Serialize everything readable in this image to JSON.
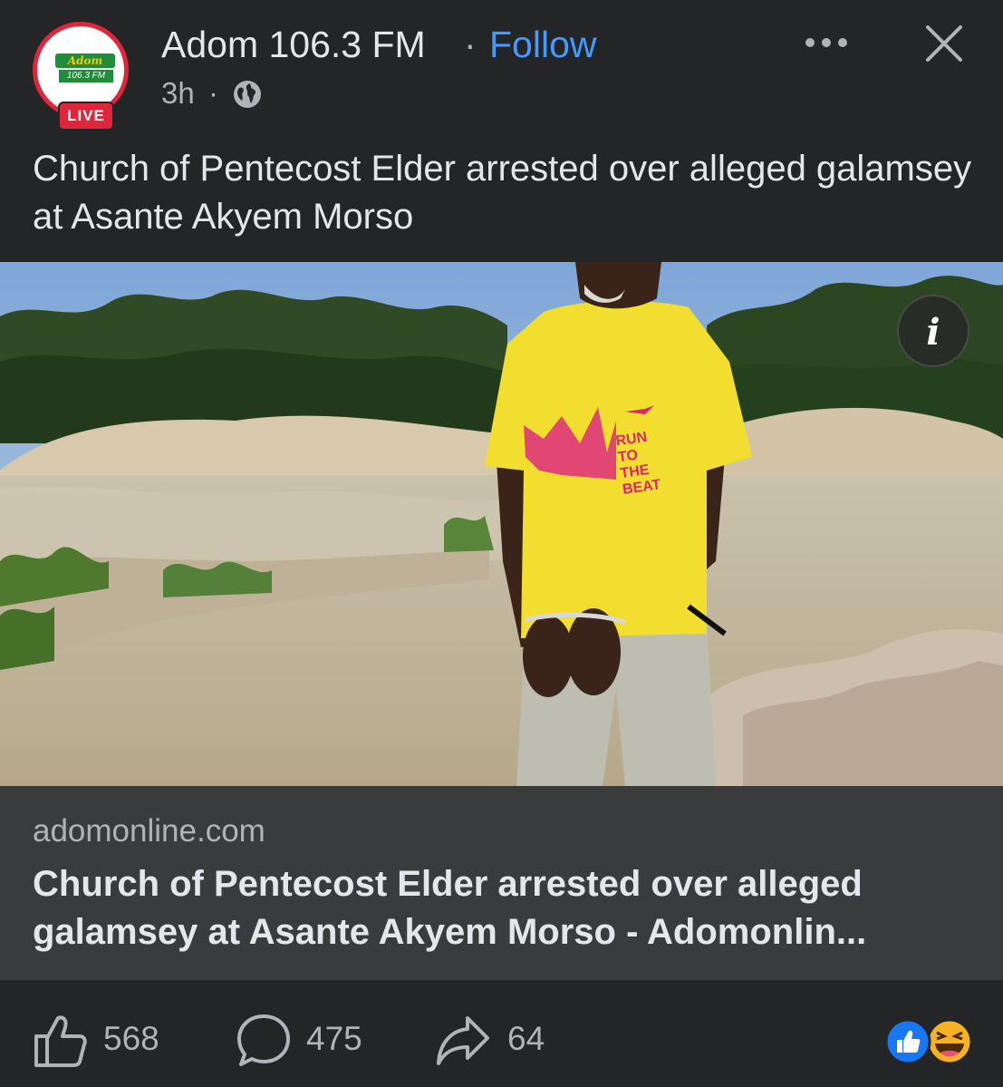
{
  "post": {
    "page_name": "Adom 106.3 FM",
    "separator": "·",
    "follow_label": "Follow",
    "time": "3h",
    "time_separator": "·",
    "live_label": "LIVE",
    "logo_text_top": "Adom",
    "logo_text_bottom": "106.3 FM",
    "caption": "Church of Pentecost Elder arrested over alleged galamsey at Asante Akyem Morso"
  },
  "photo": {
    "shirt_text": [
      "RUN",
      "TO",
      "THE",
      "BEAT"
    ],
    "info_label": "i"
  },
  "link": {
    "domain": "adomonline.com",
    "title": "Church of Pentecost Elder arrested over alleged galamsey at Asante Akyem Morso - Adomonlin..."
  },
  "actions": {
    "likes": "568",
    "comments": "475",
    "shares": "64"
  },
  "icons": {
    "more": "more-horizontal-icon",
    "close": "close-icon",
    "audience": "globe-icon",
    "like": "thumbs-up-icon",
    "comment": "comment-bubble-icon",
    "share": "share-arrow-icon",
    "reaction_like": "like-reaction-icon",
    "reaction_haha": "haha-reaction-icon"
  },
  "colors": {
    "background": "#242526",
    "link_card": "#3a3b3c",
    "follow_blue": "#4599ff",
    "live_red": "#e0263a",
    "secondary_text": "#b0b3b8"
  }
}
